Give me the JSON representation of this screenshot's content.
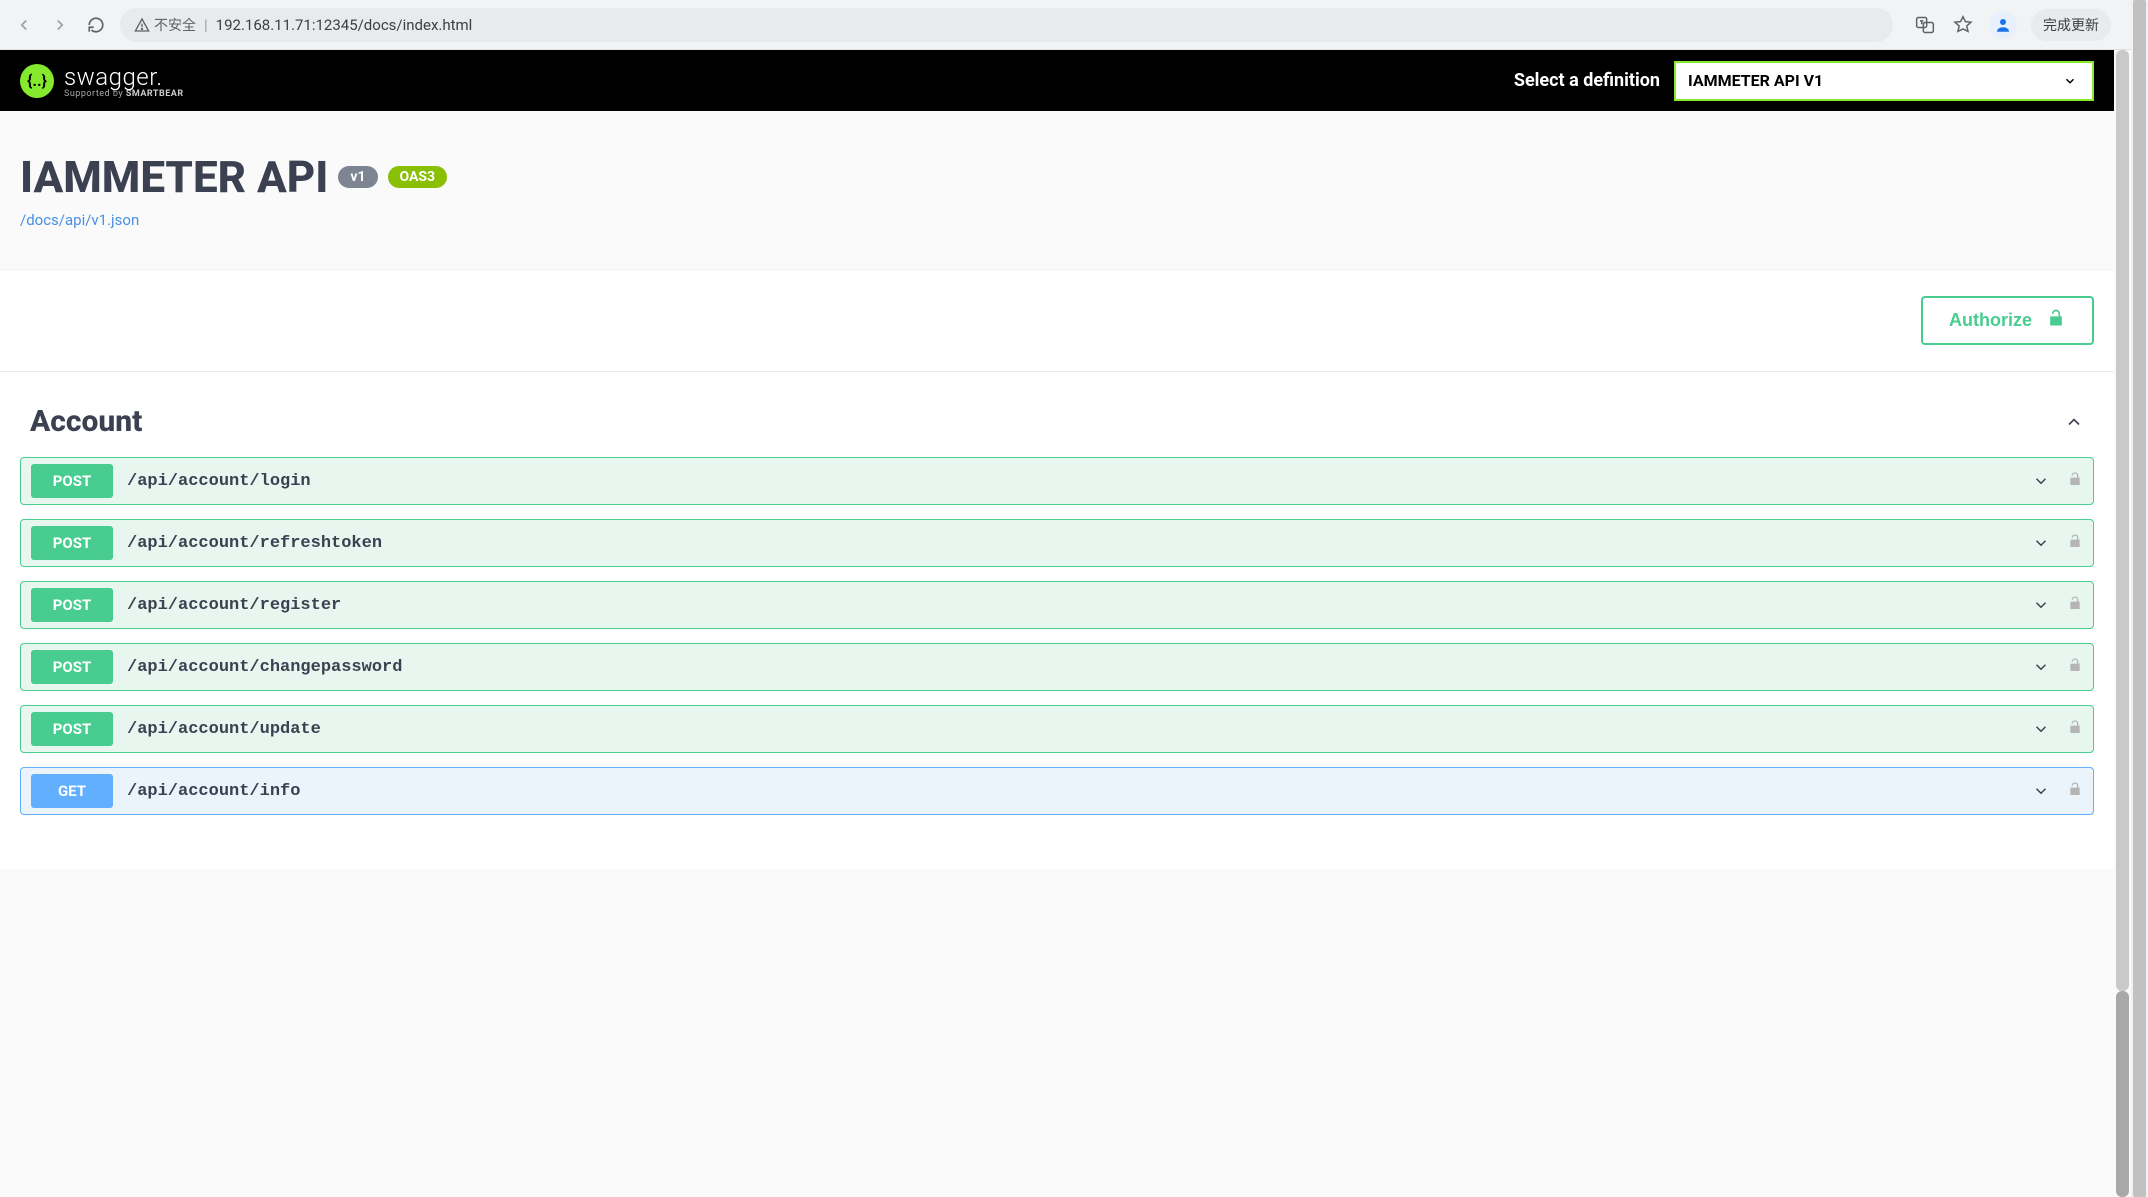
{
  "browser": {
    "insecure_label": "不安全",
    "url": "192.168.11.71:12345/docs/index.html",
    "update_label": "完成更新"
  },
  "header": {
    "brand": "swagger",
    "supported_by": "Supported by ",
    "supported_brand": "SMARTBEAR",
    "select_label": "Select a definition",
    "selected_definition": "IAMMETER API V1"
  },
  "info": {
    "title": "IAMMETER API",
    "version_badge": "v1",
    "oas_badge": "OAS3",
    "spec_link": "/docs/api/v1.json"
  },
  "authorize": {
    "label": "Authorize"
  },
  "tag": {
    "name": "Account"
  },
  "operations": [
    {
      "method": "POST",
      "method_class": "post",
      "path": "/api/account/login"
    },
    {
      "method": "POST",
      "method_class": "post",
      "path": "/api/account/refreshtoken"
    },
    {
      "method": "POST",
      "method_class": "post",
      "path": "/api/account/register"
    },
    {
      "method": "POST",
      "method_class": "post",
      "path": "/api/account/changepassword"
    },
    {
      "method": "POST",
      "method_class": "post",
      "path": "/api/account/update"
    },
    {
      "method": "GET",
      "method_class": "get",
      "path": "/api/account/info"
    }
  ]
}
